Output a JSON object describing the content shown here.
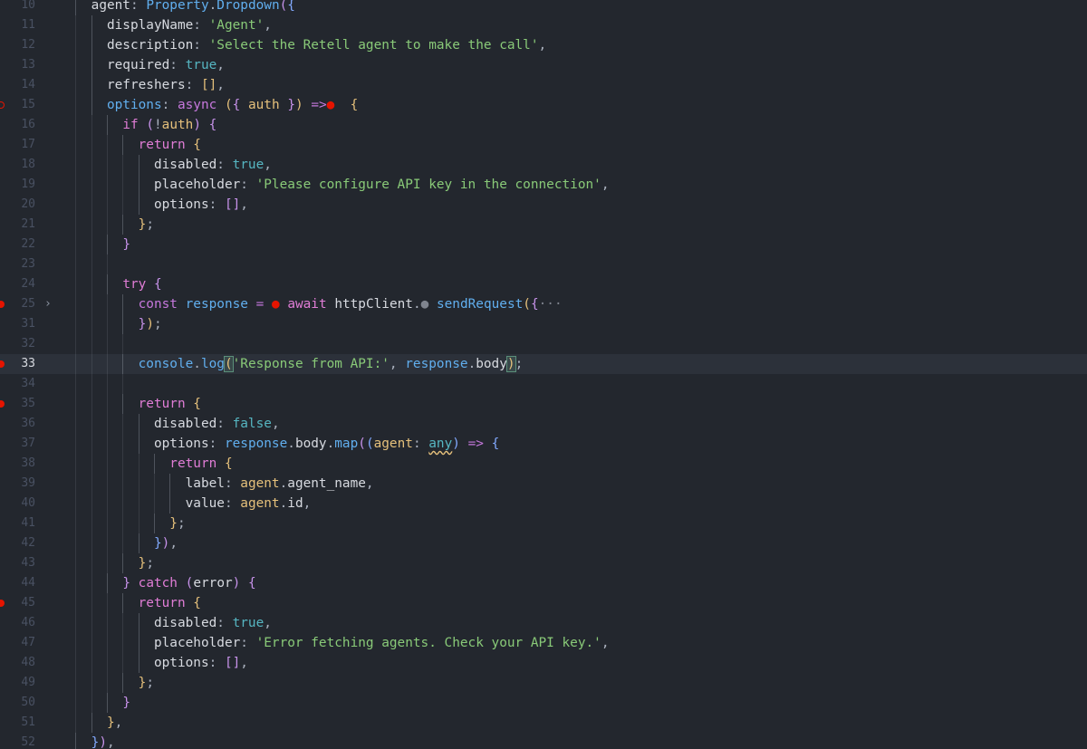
{
  "editor": {
    "lines": [
      {
        "n": "10",
        "depth": 2,
        "bp": "none",
        "fold": false,
        "current": false,
        "tokens": [
          [
            "t-prop",
            "agent"
          ],
          [
            "t-punc",
            ": "
          ],
          [
            "t-obj",
            "Property"
          ],
          [
            "t-punc",
            "."
          ],
          [
            "t-fn",
            "Dropdown"
          ],
          [
            "t-brk1",
            "("
          ],
          [
            "t-brk2",
            "{"
          ]
        ]
      },
      {
        "n": "11",
        "depth": 3,
        "bp": "none",
        "fold": false,
        "current": false,
        "tokens": [
          [
            "t-prop",
            "displayName"
          ],
          [
            "t-punc",
            ": "
          ],
          [
            "t-str",
            "'Agent'"
          ],
          [
            "t-punc",
            ","
          ]
        ]
      },
      {
        "n": "12",
        "depth": 3,
        "bp": "none",
        "fold": false,
        "current": false,
        "tokens": [
          [
            "t-prop",
            "description"
          ],
          [
            "t-punc",
            ": "
          ],
          [
            "t-str",
            "'Select the Retell agent to make the call'"
          ],
          [
            "t-punc",
            ","
          ]
        ]
      },
      {
        "n": "13",
        "depth": 3,
        "bp": "none",
        "fold": false,
        "current": false,
        "tokens": [
          [
            "t-prop",
            "required"
          ],
          [
            "t-punc",
            ": "
          ],
          [
            "t-bool",
            "true"
          ],
          [
            "t-punc",
            ","
          ]
        ]
      },
      {
        "n": "14",
        "depth": 3,
        "bp": "none",
        "fold": false,
        "current": false,
        "tokens": [
          [
            "t-prop",
            "refreshers"
          ],
          [
            "t-punc",
            ": "
          ],
          [
            "t-brk3",
            "[]"
          ],
          [
            "t-punc",
            ","
          ]
        ]
      },
      {
        "n": "15",
        "depth": 3,
        "bp": "hollow",
        "fold": false,
        "current": false,
        "tokens": [
          [
            "t-fn",
            "options"
          ],
          [
            "t-punc",
            ": "
          ],
          [
            "t-kw",
            "async"
          ],
          [
            "t-punc",
            " "
          ],
          [
            "t-brk3",
            "("
          ],
          [
            "t-brk1",
            "{"
          ],
          [
            "t-punc",
            " "
          ],
          [
            "t-param",
            "auth"
          ],
          [
            "t-punc",
            " "
          ],
          [
            "t-brk1",
            "}"
          ],
          [
            "t-brk3",
            ")"
          ],
          [
            "t-punc",
            " "
          ],
          [
            "t-op",
            "=>"
          ],
          [
            "t-dot",
            "●"
          ],
          [
            "t-punc",
            "  "
          ],
          [
            "t-brk3",
            "{"
          ]
        ]
      },
      {
        "n": "16",
        "depth": 4,
        "bp": "none",
        "fold": false,
        "current": false,
        "tokens": [
          [
            "t-ctl",
            "if"
          ],
          [
            "t-punc",
            " "
          ],
          [
            "t-brk1",
            "("
          ],
          [
            "t-punc",
            "!"
          ],
          [
            "t-param",
            "auth"
          ],
          [
            "t-brk1",
            ")"
          ],
          [
            "t-punc",
            " "
          ],
          [
            "t-brk1",
            "{"
          ]
        ]
      },
      {
        "n": "17",
        "depth": 5,
        "bp": "none",
        "fold": false,
        "current": false,
        "tokens": [
          [
            "t-ctl",
            "return"
          ],
          [
            "t-punc",
            " "
          ],
          [
            "t-brk3",
            "{"
          ]
        ]
      },
      {
        "n": "18",
        "depth": 6,
        "bp": "none",
        "fold": false,
        "current": false,
        "tokens": [
          [
            "t-prop",
            "disabled"
          ],
          [
            "t-punc",
            ": "
          ],
          [
            "t-bool",
            "true"
          ],
          [
            "t-punc",
            ","
          ]
        ]
      },
      {
        "n": "19",
        "depth": 6,
        "bp": "none",
        "fold": false,
        "current": false,
        "tokens": [
          [
            "t-prop",
            "placeholder"
          ],
          [
            "t-punc",
            ": "
          ],
          [
            "t-str",
            "'Please configure API key in the connection'"
          ],
          [
            "t-punc",
            ","
          ]
        ]
      },
      {
        "n": "20",
        "depth": 6,
        "bp": "none",
        "fold": false,
        "current": false,
        "tokens": [
          [
            "t-prop",
            "options"
          ],
          [
            "t-punc",
            ": "
          ],
          [
            "t-brk1",
            "[]"
          ],
          [
            "t-punc",
            ","
          ]
        ]
      },
      {
        "n": "21",
        "depth": 5,
        "bp": "none",
        "fold": false,
        "current": false,
        "tokens": [
          [
            "t-brk3",
            "}"
          ],
          [
            "t-punc",
            ";"
          ]
        ]
      },
      {
        "n": "22",
        "depth": 4,
        "bp": "none",
        "fold": false,
        "current": false,
        "tokens": [
          [
            "t-brk1",
            "}"
          ]
        ]
      },
      {
        "n": "23",
        "depth": 4,
        "bp": "none",
        "fold": false,
        "current": false,
        "tokens": []
      },
      {
        "n": "24",
        "depth": 4,
        "bp": "none",
        "fold": false,
        "current": false,
        "tokens": [
          [
            "t-ctl",
            "try"
          ],
          [
            "t-punc",
            " "
          ],
          [
            "t-brk1",
            "{"
          ]
        ]
      },
      {
        "n": "25",
        "depth": 5,
        "bp": "solid",
        "fold": true,
        "current": false,
        "tokens": [
          [
            "t-kw",
            "const"
          ],
          [
            "t-punc",
            " "
          ],
          [
            "t-obj",
            "response"
          ],
          [
            "t-punc",
            " "
          ],
          [
            "t-op",
            "="
          ],
          [
            "t-punc",
            " "
          ],
          [
            "t-dot",
            "●"
          ],
          [
            "t-punc",
            " "
          ],
          [
            "t-ctl",
            "await"
          ],
          [
            "t-punc",
            " "
          ],
          [
            "t-ident",
            "httpClient"
          ],
          [
            "t-punc",
            "."
          ],
          [
            "t-gdot",
            "●"
          ],
          [
            "t-punc",
            " "
          ],
          [
            "t-fn",
            "sendRequest"
          ],
          [
            "t-brk3",
            "("
          ],
          [
            "t-brk1",
            "{"
          ],
          [
            "t-ell",
            "···"
          ]
        ]
      },
      {
        "n": "31",
        "depth": 5,
        "bp": "none",
        "fold": false,
        "current": false,
        "tokens": [
          [
            "t-brk1",
            "}"
          ],
          [
            "t-brk3",
            ")"
          ],
          [
            "t-punc",
            ";"
          ]
        ]
      },
      {
        "n": "32",
        "depth": 5,
        "bp": "none",
        "fold": false,
        "current": false,
        "tokens": []
      },
      {
        "n": "33",
        "depth": 5,
        "bp": "solid",
        "fold": false,
        "current": true,
        "tokens": [
          [
            "t-obj",
            "console"
          ],
          [
            "t-punc",
            "."
          ],
          [
            "t-fn",
            "log"
          ],
          [
            "t-brk3 hl-paren",
            "("
          ],
          [
            "t-str",
            "'Response from API:'"
          ],
          [
            "t-punc",
            ", "
          ],
          [
            "t-obj",
            "response"
          ],
          [
            "t-punc",
            "."
          ],
          [
            "t-prop",
            "body"
          ],
          [
            "t-brk3 hl-paren",
            ")"
          ],
          [
            "t-punc",
            ";"
          ]
        ]
      },
      {
        "n": "34",
        "depth": 5,
        "bp": "none",
        "fold": false,
        "current": false,
        "tokens": []
      },
      {
        "n": "35",
        "depth": 5,
        "bp": "solid",
        "fold": false,
        "current": false,
        "tokens": [
          [
            "t-ctl",
            "return"
          ],
          [
            "t-punc",
            " "
          ],
          [
            "t-brk3",
            "{"
          ]
        ]
      },
      {
        "n": "36",
        "depth": 6,
        "bp": "none",
        "fold": false,
        "current": false,
        "tokens": [
          [
            "t-prop",
            "disabled"
          ],
          [
            "t-punc",
            ": "
          ],
          [
            "t-bool",
            "false"
          ],
          [
            "t-punc",
            ","
          ]
        ]
      },
      {
        "n": "37",
        "depth": 6,
        "bp": "none",
        "fold": false,
        "current": false,
        "tokens": [
          [
            "t-prop",
            "options"
          ],
          [
            "t-punc",
            ": "
          ],
          [
            "t-obj",
            "response"
          ],
          [
            "t-punc",
            "."
          ],
          [
            "t-prop",
            "body"
          ],
          [
            "t-punc",
            "."
          ],
          [
            "t-fn",
            "map"
          ],
          [
            "t-brk1",
            "("
          ],
          [
            "t-brk2",
            "("
          ],
          [
            "t-param",
            "agent"
          ],
          [
            "t-punc",
            ": "
          ],
          [
            "t-type",
            "any"
          ],
          [
            "t-brk2",
            ")"
          ],
          [
            "t-punc",
            " "
          ],
          [
            "t-op",
            "=>"
          ],
          [
            "t-punc",
            " "
          ],
          [
            "t-brk2",
            "{"
          ]
        ]
      },
      {
        "n": "38",
        "depth": 7,
        "bp": "none",
        "fold": false,
        "current": false,
        "tokens": [
          [
            "t-ctl",
            "return"
          ],
          [
            "t-punc",
            " "
          ],
          [
            "t-brk3",
            "{"
          ]
        ]
      },
      {
        "n": "39",
        "depth": 8,
        "bp": "none",
        "fold": false,
        "current": false,
        "tokens": [
          [
            "t-prop",
            "label"
          ],
          [
            "t-punc",
            ": "
          ],
          [
            "t-param",
            "agent"
          ],
          [
            "t-punc",
            "."
          ],
          [
            "t-prop",
            "agent_name"
          ],
          [
            "t-punc",
            ","
          ]
        ]
      },
      {
        "n": "40",
        "depth": 8,
        "bp": "none",
        "fold": false,
        "current": false,
        "tokens": [
          [
            "t-prop",
            "value"
          ],
          [
            "t-punc",
            ": "
          ],
          [
            "t-param",
            "agent"
          ],
          [
            "t-punc",
            "."
          ],
          [
            "t-prop",
            "id"
          ],
          [
            "t-punc",
            ","
          ]
        ]
      },
      {
        "n": "41",
        "depth": 7,
        "bp": "none",
        "fold": false,
        "current": false,
        "tokens": [
          [
            "t-brk3",
            "}"
          ],
          [
            "t-punc",
            ";"
          ]
        ]
      },
      {
        "n": "42",
        "depth": 6,
        "bp": "none",
        "fold": false,
        "current": false,
        "tokens": [
          [
            "t-brk2",
            "}"
          ],
          [
            "t-brk1",
            ")"
          ],
          [
            "t-punc",
            ","
          ]
        ]
      },
      {
        "n": "43",
        "depth": 5,
        "bp": "none",
        "fold": false,
        "current": false,
        "tokens": [
          [
            "t-brk3",
            "}"
          ],
          [
            "t-punc",
            ";"
          ]
        ]
      },
      {
        "n": "44",
        "depth": 4,
        "bp": "none",
        "fold": false,
        "current": false,
        "tokens": [
          [
            "t-brk1",
            "}"
          ],
          [
            "t-punc",
            " "
          ],
          [
            "t-ctl",
            "catch"
          ],
          [
            "t-punc",
            " "
          ],
          [
            "t-brk1",
            "("
          ],
          [
            "t-ident",
            "error"
          ],
          [
            "t-brk1",
            ")"
          ],
          [
            "t-punc",
            " "
          ],
          [
            "t-brk1",
            "{"
          ]
        ]
      },
      {
        "n": "45",
        "depth": 5,
        "bp": "solid",
        "fold": false,
        "current": false,
        "tokens": [
          [
            "t-ctl",
            "return"
          ],
          [
            "t-punc",
            " "
          ],
          [
            "t-brk3",
            "{"
          ]
        ]
      },
      {
        "n": "46",
        "depth": 6,
        "bp": "none",
        "fold": false,
        "current": false,
        "tokens": [
          [
            "t-prop",
            "disabled"
          ],
          [
            "t-punc",
            ": "
          ],
          [
            "t-bool",
            "true"
          ],
          [
            "t-punc",
            ","
          ]
        ]
      },
      {
        "n": "47",
        "depth": 6,
        "bp": "none",
        "fold": false,
        "current": false,
        "tokens": [
          [
            "t-prop",
            "placeholder"
          ],
          [
            "t-punc",
            ": "
          ],
          [
            "t-str",
            "'Error fetching agents. Check your API key.'"
          ],
          [
            "t-punc",
            ","
          ]
        ]
      },
      {
        "n": "48",
        "depth": 6,
        "bp": "none",
        "fold": false,
        "current": false,
        "tokens": [
          [
            "t-prop",
            "options"
          ],
          [
            "t-punc",
            ": "
          ],
          [
            "t-brk1",
            "[]"
          ],
          [
            "t-punc",
            ","
          ]
        ]
      },
      {
        "n": "49",
        "depth": 5,
        "bp": "none",
        "fold": false,
        "current": false,
        "tokens": [
          [
            "t-brk3",
            "}"
          ],
          [
            "t-punc",
            ";"
          ]
        ]
      },
      {
        "n": "50",
        "depth": 4,
        "bp": "none",
        "fold": false,
        "current": false,
        "tokens": [
          [
            "t-brk1",
            "}"
          ]
        ]
      },
      {
        "n": "51",
        "depth": 3,
        "bp": "none",
        "fold": false,
        "current": false,
        "tokens": [
          [
            "t-brk3",
            "}"
          ],
          [
            "t-punc",
            ","
          ]
        ]
      },
      {
        "n": "52",
        "depth": 2,
        "bp": "none",
        "fold": false,
        "current": false,
        "tokens": [
          [
            "t-brk2",
            "}"
          ],
          [
            "t-brk1",
            ")"
          ],
          [
            "t-punc",
            ","
          ]
        ]
      }
    ]
  }
}
